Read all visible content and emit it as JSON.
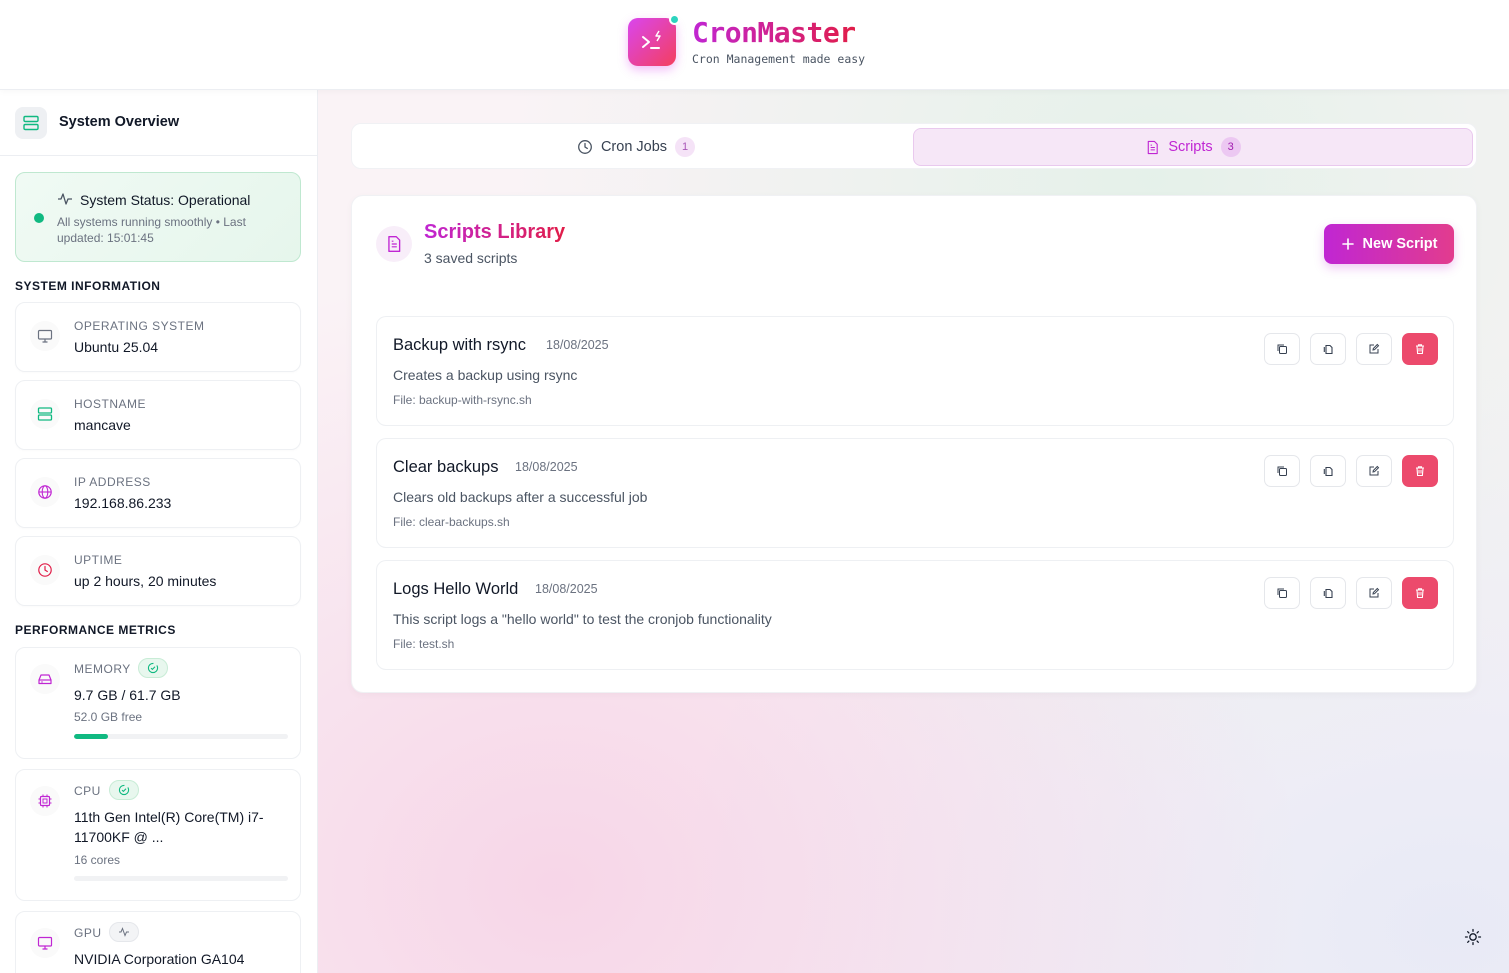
{
  "app": {
    "title": "CronMaster",
    "subtitle": "Cron Management made easy"
  },
  "sidebar": {
    "header": "System Overview",
    "status": {
      "title": "System Status: Operational",
      "description": "All systems running smoothly • Last updated: 15:01:45",
      "color": "#10b981"
    },
    "system_info": {
      "label": "SYSTEM INFORMATION",
      "items": [
        {
          "label": "OPERATING SYSTEM",
          "value": "Ubuntu 25.04",
          "icon": "monitor-icon"
        },
        {
          "label": "HOSTNAME",
          "value": "mancave",
          "icon": "server-icon"
        },
        {
          "label": "IP ADDRESS",
          "value": "192.168.86.233",
          "icon": "globe-icon"
        },
        {
          "label": "UPTIME",
          "value": "up 2 hours, 20 minutes",
          "icon": "clock-icon"
        }
      ]
    },
    "performance": {
      "label": "PERFORMANCE METRICS",
      "memory": {
        "label": "MEMORY",
        "value": "9.7 GB / 61.7 GB",
        "sub": "52.0 GB free",
        "usage_fraction": 0.157,
        "icon": "hard-drive-icon"
      },
      "cpu": {
        "label": "CPU",
        "value": "11th Gen Intel(R) Core(TM) i7-11700KF @ ...",
        "sub": "16 cores",
        "usage_fraction": 0.0,
        "icon": "cpu-icon"
      },
      "gpu": {
        "label": "GPU",
        "value": "NVIDIA Corporation GA104",
        "icon": "gpu-monitor-icon"
      }
    }
  },
  "tabs": [
    {
      "label": "Cron Jobs",
      "count": "1",
      "active": false
    },
    {
      "label": "Scripts",
      "count": "3",
      "active": true
    }
  ],
  "library": {
    "title": "Scripts Library",
    "subtitle": "3 saved scripts",
    "new_button": "New Script",
    "scripts": [
      {
        "name": "Backup with rsync",
        "date": "18/08/2025",
        "description": "Creates a backup using rsync",
        "file": "File: backup-with-rsync.sh"
      },
      {
        "name": "Clear backups",
        "date": "18/08/2025",
        "description": "Clears old backups after a successful job",
        "file": "File: clear-backups.sh"
      },
      {
        "name": "Logs Hello World",
        "date": "18/08/2025",
        "description": "This script logs a \"hello world\" to test the cronjob functionality",
        "file": "File: test.sh"
      }
    ]
  },
  "colors": {
    "accent": "#c026d3",
    "danger": "#ec4a6c",
    "success": "#10b981"
  }
}
